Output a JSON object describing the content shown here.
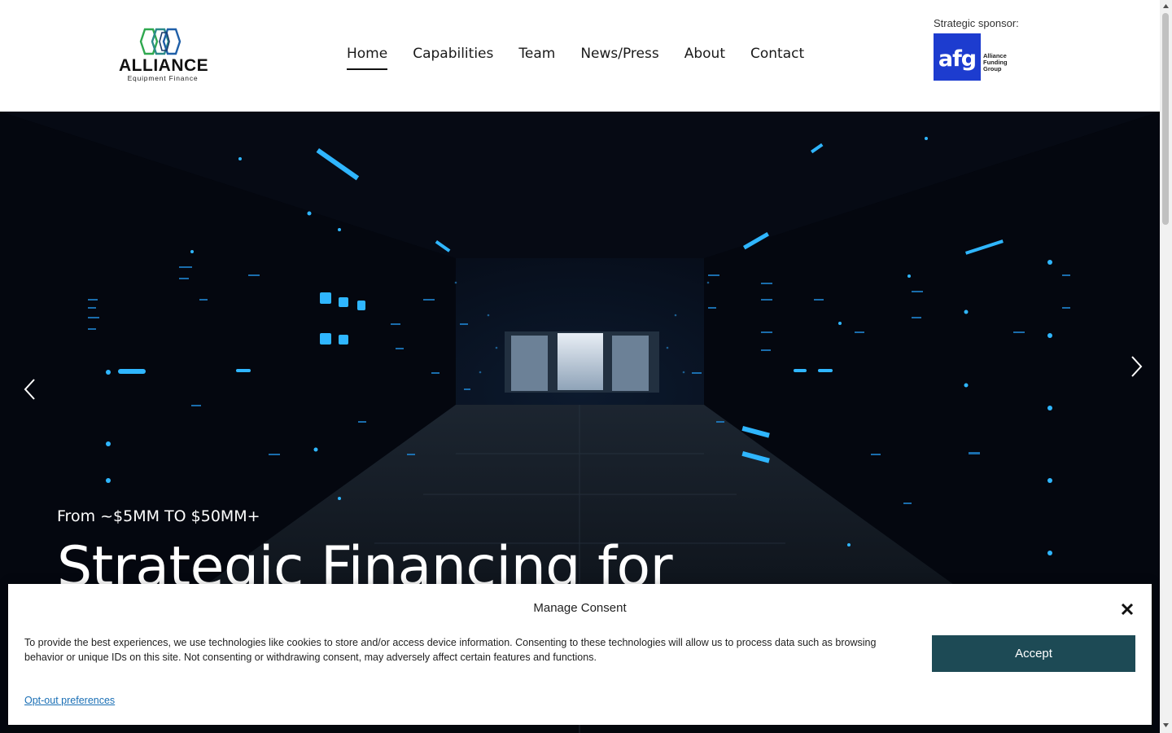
{
  "header": {
    "logo": {
      "name": "ALLIANCE",
      "tagline": "Equipment Finance"
    },
    "nav": [
      {
        "label": "Home",
        "active": true
      },
      {
        "label": "Capabilities",
        "active": false
      },
      {
        "label": "Team",
        "active": false
      },
      {
        "label": "News/Press",
        "active": false
      },
      {
        "label": "About",
        "active": false
      },
      {
        "label": "Contact",
        "active": false
      }
    ],
    "sponsor": {
      "label": "Strategic sponsor:",
      "logo_mark": "afg",
      "logo_text_1": "Alliance",
      "logo_text_2": "Funding",
      "logo_text_3": "Group"
    }
  },
  "hero": {
    "kicker": "From ~$5MM TO $50MM+",
    "title": "Strategic Financing for",
    "prev_icon": "chevron-left-icon",
    "next_icon": "chevron-right-icon"
  },
  "consent": {
    "title": "Manage Consent",
    "body": "To provide the best experiences, we use technologies like cookies to store and/or access device information. Consenting to these technologies will allow us to process data such as browsing behavior or unique IDs on this site. Not consenting or withdrawing consent, may adversely affect certain features and functions.",
    "accept_label": "Accept",
    "optout_label": "Opt-out preferences"
  },
  "colors": {
    "accept_button": "#1d4a55",
    "sponsor_blue": "#1d3ccf",
    "logo_green": "#2fa84f",
    "logo_blue": "#1f5fa8"
  }
}
